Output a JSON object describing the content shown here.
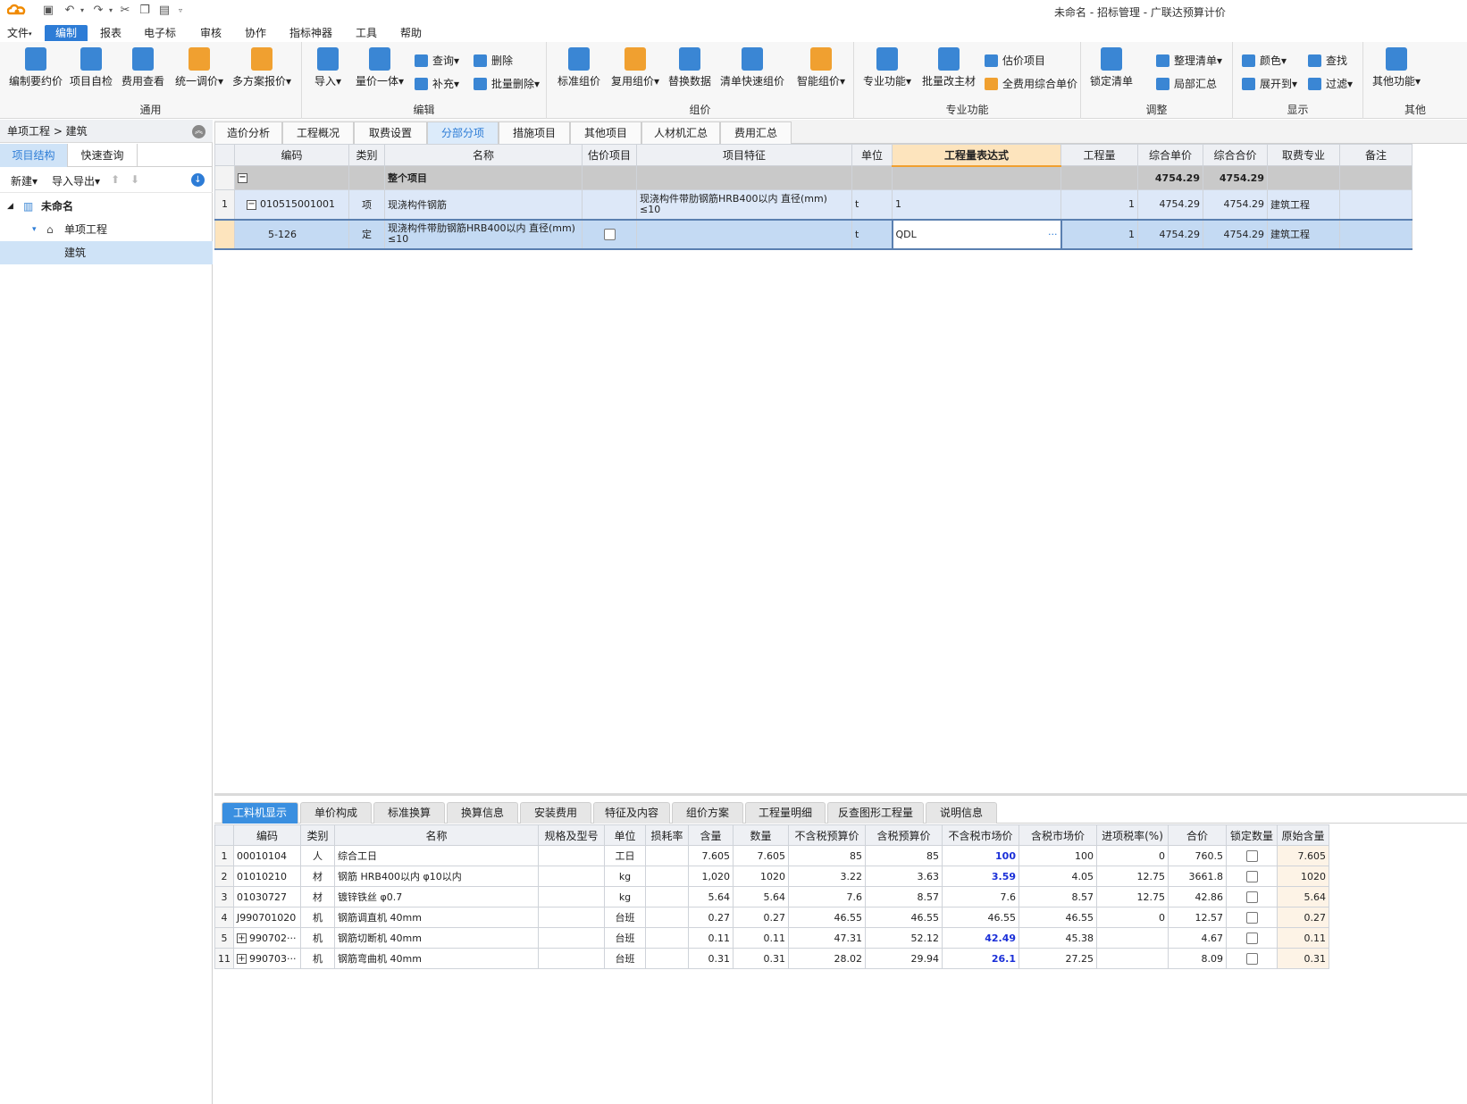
{
  "app": {
    "title": "未命名 - 招标管理 - 广联达预算计价"
  },
  "menu": [
    "文件",
    "编制",
    "报表",
    "电子标",
    "审核",
    "协作",
    "指标神器",
    "工具",
    "帮助"
  ],
  "ribbon": {
    "groups": {
      "general": "通用",
      "edit": "编辑",
      "pricing": "组价",
      "special": "专业功能",
      "adjust": "调整",
      "display": "显示",
      "other": "其他"
    },
    "general": [
      "编制要约价",
      "项目自检",
      "费用查看",
      "统一调价",
      "多方案报价"
    ],
    "edit_big": [
      "导入",
      "量价一体"
    ],
    "edit_small": [
      "查询",
      "删除",
      "补充",
      "批量删除"
    ],
    "pricing": [
      "标准组价",
      "复用组价",
      "替换数据",
      "清单快速组价",
      "智能组价"
    ],
    "special_big": [
      "专业功能",
      "批量改主材"
    ],
    "special_small": [
      "估价项目",
      "全费用综合单价"
    ],
    "adjust_big": [
      "锁定清单"
    ],
    "adjust_small": [
      "整理清单",
      "局部汇总"
    ],
    "display_small": [
      "颜色",
      "查找",
      "展开到",
      "过滤"
    ],
    "other": [
      "其他功能"
    ]
  },
  "left": {
    "breadcrumb": "单项工程 > 建筑",
    "tabs": [
      "项目结构",
      "快速查询"
    ],
    "tools": {
      "new": "新建",
      "import": "导入导出"
    },
    "tree": {
      "root": "未命名",
      "child": "单项工程",
      "leaf": "建筑"
    }
  },
  "main_tabs": [
    "造价分析",
    "工程概况",
    "取费设置",
    "分部分项",
    "措施项目",
    "其他项目",
    "人材机汇总",
    "费用汇总"
  ],
  "grid": {
    "headers": [
      "编码",
      "类别",
      "名称",
      "估价项目",
      "项目特征",
      "单位",
      "工程量表达式",
      "工程量",
      "综合单价",
      "综合合价",
      "取费专业",
      "备注"
    ],
    "total": {
      "name": "整个项目",
      "unit_price": "4754.29",
      "total": "4754.29"
    },
    "rows": [
      {
        "no": "1",
        "code": "010515001001",
        "type": "项",
        "name": "现浇构件钢筋",
        "feature": "现浇构件带肋钢筋HRB400以内 直径(mm) ≤10",
        "unit": "t",
        "expr": "1",
        "qty": "1",
        "unit_price": "4754.29",
        "total": "4754.29",
        "fee": "建筑工程"
      },
      {
        "no": "",
        "code": "5-126",
        "type": "定",
        "name": "现浇构件带肋钢筋HRB400以内 直径(mm) ≤10",
        "feature": "",
        "unit": "t",
        "expr": "QDL",
        "qty": "1",
        "unit_price": "4754.29",
        "total": "4754.29",
        "fee": "建筑工程"
      }
    ]
  },
  "bottom_tabs": [
    "工料机显示",
    "单价构成",
    "标准换算",
    "换算信息",
    "安装费用",
    "特征及内容",
    "组价方案",
    "工程量明细",
    "反查图形工程量",
    "说明信息"
  ],
  "subgrid": {
    "headers": [
      "编码",
      "类别",
      "名称",
      "规格及型号",
      "单位",
      "损耗率",
      "含量",
      "数量",
      "不含税预算价",
      "含税预算价",
      "不含税市场价",
      "含税市场价",
      "进项税率(%)",
      "合价",
      "锁定数量",
      "原始含量"
    ],
    "rows": [
      {
        "no": "1",
        "code": "00010104",
        "type": "人",
        "name": "综合工日",
        "spec": "",
        "unit": "工日",
        "loss": "",
        "content": "7.605",
        "qty": "7.605",
        "bp": "85",
        "bpt": "85",
        "mp": "100",
        "mpt": "100",
        "tax": "0",
        "total": "760.5",
        "orig": "7.605"
      },
      {
        "no": "2",
        "code": "01010210",
        "type": "材",
        "name": "钢筋 HRB400以内 φ10以内",
        "spec": "",
        "unit": "kg",
        "loss": "",
        "content": "1,020",
        "qty": "1020",
        "bp": "3.22",
        "bpt": "3.63",
        "mp": "3.59",
        "mpt": "4.05",
        "tax": "12.75",
        "total": "3661.8",
        "orig": "1020"
      },
      {
        "no": "3",
        "code": "01030727",
        "type": "材",
        "name": "镀锌铁丝 φ0.7",
        "spec": "",
        "unit": "kg",
        "loss": "",
        "content": "5.64",
        "qty": "5.64",
        "bp": "7.6",
        "bpt": "8.57",
        "mp": "7.6",
        "mpt": "8.57",
        "tax": "12.75",
        "total": "42.86",
        "orig": "5.64"
      },
      {
        "no": "4",
        "code": "J990701020",
        "type": "机",
        "name": "钢筋调直机 40mm",
        "spec": "",
        "unit": "台班",
        "loss": "",
        "content": "0.27",
        "qty": "0.27",
        "bp": "46.55",
        "bpt": "46.55",
        "mp": "46.55",
        "mpt": "46.55",
        "tax": "0",
        "total": "12.57",
        "orig": "0.27"
      },
      {
        "no": "5",
        "code": "990702···",
        "type": "机",
        "name": "钢筋切断机 40mm",
        "spec": "",
        "unit": "台班",
        "loss": "",
        "content": "0.11",
        "qty": "0.11",
        "bp": "47.31",
        "bpt": "52.12",
        "mp": "42.49",
        "mpt": "45.38",
        "tax": "",
        "total": "4.67",
        "orig": "0.11"
      },
      {
        "no": "11",
        "code": "990703···",
        "type": "机",
        "name": "钢筋弯曲机 40mm",
        "spec": "",
        "unit": "台班",
        "loss": "",
        "content": "0.31",
        "qty": "0.31",
        "bp": "28.02",
        "bpt": "29.94",
        "mp": "26.1",
        "mpt": "27.25",
        "tax": "",
        "total": "8.09",
        "orig": "0.31"
      }
    ]
  },
  "colors": {
    "accent": "#2d7cd6",
    "selected_row": "#c4daf3",
    "highlight_header": "#fde4bd",
    "market_price": "#1a2fd8"
  },
  "icons": [
    "app-logo-icon",
    "save-icon",
    "undo-icon",
    "redo-icon",
    "cut-icon",
    "copy-icon",
    "paste-icon",
    "building-icon",
    "home-icon",
    "arrow-up-icon",
    "arrow-down-icon",
    "download-icon"
  ]
}
